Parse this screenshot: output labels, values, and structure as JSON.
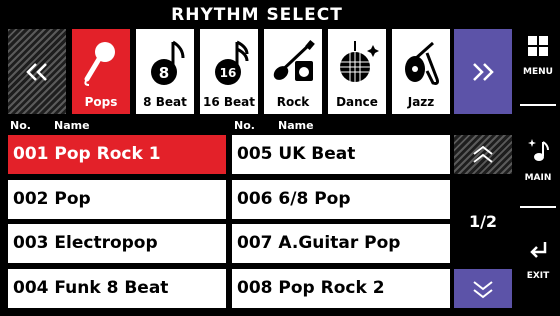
{
  "header": {
    "title": "RHYTHM SELECT"
  },
  "categories": [
    {
      "label": "Pops",
      "icon": "microphone-icon",
      "active": true
    },
    {
      "label": "8 Beat",
      "icon": "note-8-icon"
    },
    {
      "label": "16 Beat",
      "icon": "note-16-icon"
    },
    {
      "label": "Rock",
      "icon": "guitar-amp-icon"
    },
    {
      "label": "Dance",
      "icon": "disco-ball-icon"
    },
    {
      "label": "Jazz",
      "icon": "sax-icon"
    }
  ],
  "list": {
    "col_no": "No.",
    "col_name": "Name",
    "left": [
      {
        "text": "001 Pop Rock 1",
        "selected": true
      },
      {
        "text": "002 Pop"
      },
      {
        "text": "003 Electropop"
      },
      {
        "text": "004 Funk 8 Beat"
      }
    ],
    "right": [
      {
        "text": "005 UK Beat"
      },
      {
        "text": "006 6/8 Pop"
      },
      {
        "text": "007 A.Guitar Pop"
      },
      {
        "text": "008 Pop Rock 2"
      }
    ]
  },
  "pager": {
    "page": "1/2"
  },
  "sidebar": {
    "menu": "MENU",
    "main": "MAIN",
    "exit": "EXIT"
  },
  "colors": {
    "accent_red": "#e32129",
    "accent_purple": "#5c53a8"
  }
}
